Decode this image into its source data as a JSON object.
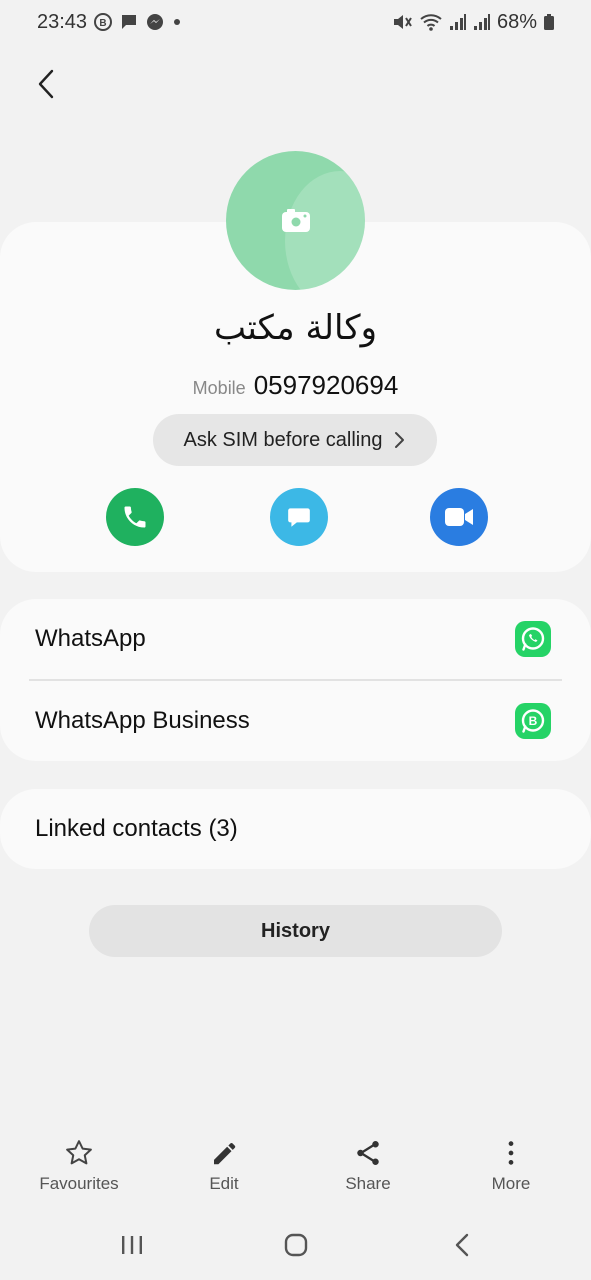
{
  "status_bar": {
    "time": "23:43",
    "battery": "68%",
    "icons": [
      "business-badge-icon",
      "message-icon",
      "messenger-icon",
      "dot-icon",
      "mute-icon",
      "wifi-icon",
      "signal-icon",
      "signal-icon",
      "battery-icon"
    ]
  },
  "contact": {
    "name": "وكالة مكتب",
    "phone_label": "Mobile",
    "phone_number": "0597920694",
    "avatar_color": "#8fd9ac"
  },
  "sim_button": {
    "label": "Ask SIM before calling"
  },
  "actions": [
    {
      "name": "call",
      "icon": "phone-icon",
      "color": "#1fb15f"
    },
    {
      "name": "message",
      "icon": "chat-bubble-icon",
      "color": "#3cb8e6"
    },
    {
      "name": "video",
      "icon": "video-camera-icon",
      "color": "#2a7de1"
    }
  ],
  "apps": [
    {
      "label": "WhatsApp",
      "icon": "whatsapp-icon"
    },
    {
      "label": "WhatsApp Business",
      "icon": "whatsapp-business-icon"
    }
  ],
  "linked_contacts": {
    "label": "Linked contacts (3)"
  },
  "history": {
    "label": "History"
  },
  "bottom_bar": {
    "favourites": "Favourites",
    "edit": "Edit",
    "share": "Share",
    "more": "More"
  },
  "colors": {
    "background": "#f2f2f2",
    "card": "#fafafa",
    "whatsapp_green": "#25d366"
  }
}
